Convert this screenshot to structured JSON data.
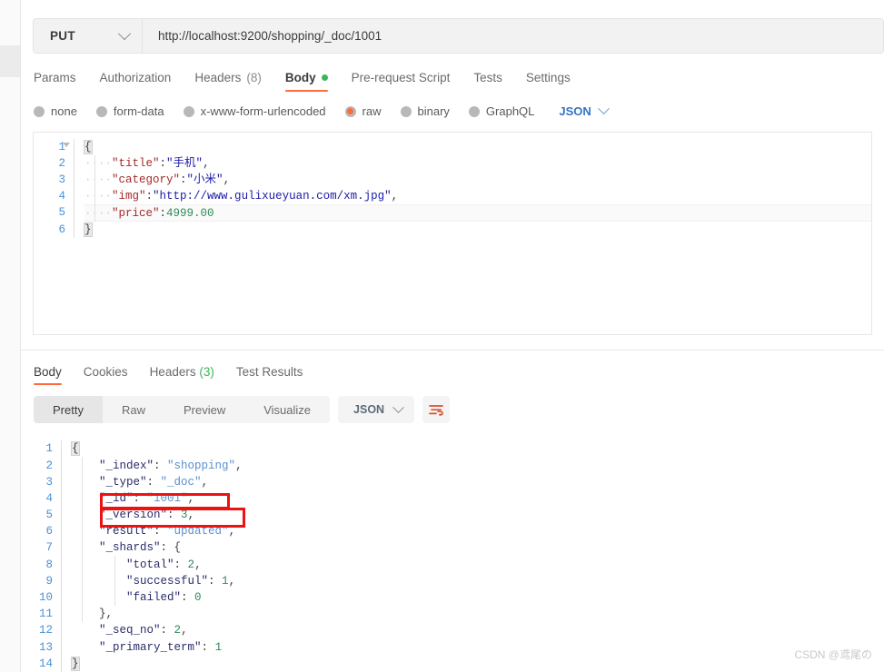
{
  "request": {
    "method": "PUT",
    "url": "http://localhost:9200/shopping/_doc/1001",
    "tabs": [
      {
        "label": "Params",
        "active": false
      },
      {
        "label": "Authorization",
        "active": false
      },
      {
        "label": "Headers",
        "count": "(8)",
        "active": false
      },
      {
        "label": "Body",
        "active": true,
        "dot": true
      },
      {
        "label": "Pre-request Script",
        "active": false
      },
      {
        "label": "Tests",
        "active": false
      },
      {
        "label": "Settings",
        "active": false
      }
    ],
    "body_types": [
      {
        "label": "none",
        "selected": false
      },
      {
        "label": "form-data",
        "selected": false
      },
      {
        "label": "x-www-form-urlencoded",
        "selected": false
      },
      {
        "label": "raw",
        "selected": true
      },
      {
        "label": "binary",
        "selected": false
      },
      {
        "label": "GraphQL",
        "selected": false
      }
    ],
    "language": "JSON",
    "body_lines": [
      {
        "n": "1",
        "segments": [
          {
            "t": "{",
            "c": "brace-box"
          }
        ]
      },
      {
        "n": "2",
        "segments": [
          {
            "t": "····",
            "c": "dots"
          },
          {
            "t": "\"title\"",
            "c": "k"
          },
          {
            "t": ":",
            "c": "p"
          },
          {
            "t": "\"手机\"",
            "c": "s"
          },
          {
            "t": ",",
            "c": "p"
          }
        ]
      },
      {
        "n": "3",
        "segments": [
          {
            "t": "····",
            "c": "dots"
          },
          {
            "t": "\"category\"",
            "c": "k"
          },
          {
            "t": ":",
            "c": "p"
          },
          {
            "t": "\"小米\"",
            "c": "s"
          },
          {
            "t": ",",
            "c": "p"
          }
        ]
      },
      {
        "n": "4",
        "segments": [
          {
            "t": "····",
            "c": "dots"
          },
          {
            "t": "\"img\"",
            "c": "k"
          },
          {
            "t": ":",
            "c": "p"
          },
          {
            "t": "\"http://www.gulixueyuan.com/xm.jpg\"",
            "c": "s"
          },
          {
            "t": ",",
            "c": "p"
          }
        ]
      },
      {
        "n": "5",
        "segments": [
          {
            "t": "····",
            "c": "dots"
          },
          {
            "t": "\"price\"",
            "c": "k"
          },
          {
            "t": ":",
            "c": "p"
          },
          {
            "t": "4999.00",
            "c": "n"
          }
        ],
        "row": "hl-row"
      },
      {
        "n": "6",
        "segments": [
          {
            "t": "}",
            "c": "brace-box"
          }
        ]
      }
    ]
  },
  "response": {
    "tabs": [
      {
        "label": "Body",
        "active": true
      },
      {
        "label": "Cookies",
        "active": false
      },
      {
        "label": "Headers",
        "count": "(3)",
        "active": false
      },
      {
        "label": "Test Results",
        "active": false
      }
    ],
    "view_modes": [
      {
        "label": "Pretty",
        "active": true
      },
      {
        "label": "Raw",
        "active": false
      },
      {
        "label": "Preview",
        "active": false
      },
      {
        "label": "Visualize",
        "active": false
      }
    ],
    "format": "JSON",
    "filter_icon": "filter-wrap-icon",
    "body_lines": [
      {
        "n": "1",
        "segments": [
          {
            "t": "{",
            "c": "brace-box"
          }
        ]
      },
      {
        "n": "2",
        "segments": [
          {
            "t": "    ",
            "c": "p"
          },
          {
            "t": "\"_index\"",
            "c": "rk"
          },
          {
            "t": ": ",
            "c": "p"
          },
          {
            "t": "\"shopping\"",
            "c": "rs"
          },
          {
            "t": ",",
            "c": "p"
          }
        ]
      },
      {
        "n": "3",
        "segments": [
          {
            "t": "    ",
            "c": "p"
          },
          {
            "t": "\"_type\"",
            "c": "rk"
          },
          {
            "t": ": ",
            "c": "p"
          },
          {
            "t": "\"_doc\"",
            "c": "rs"
          },
          {
            "t": ",",
            "c": "p"
          }
        ]
      },
      {
        "n": "4",
        "segments": [
          {
            "t": "    ",
            "c": "p"
          },
          {
            "t": "\"_id\"",
            "c": "rk"
          },
          {
            "t": ": ",
            "c": "p"
          },
          {
            "t": "\"1001\"",
            "c": "rs"
          },
          {
            "t": ",",
            "c": "p"
          }
        ]
      },
      {
        "n": "5",
        "segments": [
          {
            "t": "    ",
            "c": "p"
          },
          {
            "t": "\"_version\"",
            "c": "rk"
          },
          {
            "t": ": ",
            "c": "p"
          },
          {
            "t": "3",
            "c": "rn"
          },
          {
            "t": ",",
            "c": "p"
          }
        ]
      },
      {
        "n": "6",
        "segments": [
          {
            "t": "    ",
            "c": "p"
          },
          {
            "t": "\"result\"",
            "c": "rk"
          },
          {
            "t": ": ",
            "c": "p"
          },
          {
            "t": "\"updated\"",
            "c": "rs"
          },
          {
            "t": ",",
            "c": "p"
          }
        ]
      },
      {
        "n": "7",
        "segments": [
          {
            "t": "    ",
            "c": "p"
          },
          {
            "t": "\"_shards\"",
            "c": "rk"
          },
          {
            "t": ": ",
            "c": "p"
          },
          {
            "t": "{",
            "c": "p"
          }
        ]
      },
      {
        "n": "8",
        "segments": [
          {
            "t": "        ",
            "c": "p"
          },
          {
            "t": "\"total\"",
            "c": "rk"
          },
          {
            "t": ": ",
            "c": "p"
          },
          {
            "t": "2",
            "c": "rn"
          },
          {
            "t": ",",
            "c": "p"
          }
        ]
      },
      {
        "n": "9",
        "segments": [
          {
            "t": "        ",
            "c": "p"
          },
          {
            "t": "\"successful\"",
            "c": "rk"
          },
          {
            "t": ": ",
            "c": "p"
          },
          {
            "t": "1",
            "c": "rn"
          },
          {
            "t": ",",
            "c": "p"
          }
        ]
      },
      {
        "n": "10",
        "segments": [
          {
            "t": "        ",
            "c": "p"
          },
          {
            "t": "\"failed\"",
            "c": "rk"
          },
          {
            "t": ": ",
            "c": "p"
          },
          {
            "t": "0",
            "c": "rn"
          }
        ]
      },
      {
        "n": "11",
        "segments": [
          {
            "t": "    ",
            "c": "p"
          },
          {
            "t": "}",
            "c": "p"
          },
          {
            "t": ",",
            "c": "p"
          }
        ]
      },
      {
        "n": "12",
        "segments": [
          {
            "t": "    ",
            "c": "p"
          },
          {
            "t": "\"_seq_no\"",
            "c": "rk"
          },
          {
            "t": ": ",
            "c": "p"
          },
          {
            "t": "2",
            "c": "rn"
          },
          {
            "t": ",",
            "c": "p"
          }
        ]
      },
      {
        "n": "13",
        "segments": [
          {
            "t": "    ",
            "c": "p"
          },
          {
            "t": "\"_primary_term\"",
            "c": "rk"
          },
          {
            "t": ": ",
            "c": "p"
          },
          {
            "t": "1",
            "c": "rn"
          }
        ]
      },
      {
        "n": "14",
        "segments": [
          {
            "t": "}",
            "c": "brace-box"
          }
        ]
      }
    ]
  },
  "annotations": [
    {
      "name": "highlight-version",
      "target": "_version line"
    },
    {
      "name": "highlight-result",
      "target": "result line"
    }
  ],
  "watermark": "CSDN @鸢尾の",
  "colors": {
    "accent": "#ff6c37",
    "green": "#3ab55b",
    "annotation": "#ee1111",
    "link": "#3574c1"
  }
}
